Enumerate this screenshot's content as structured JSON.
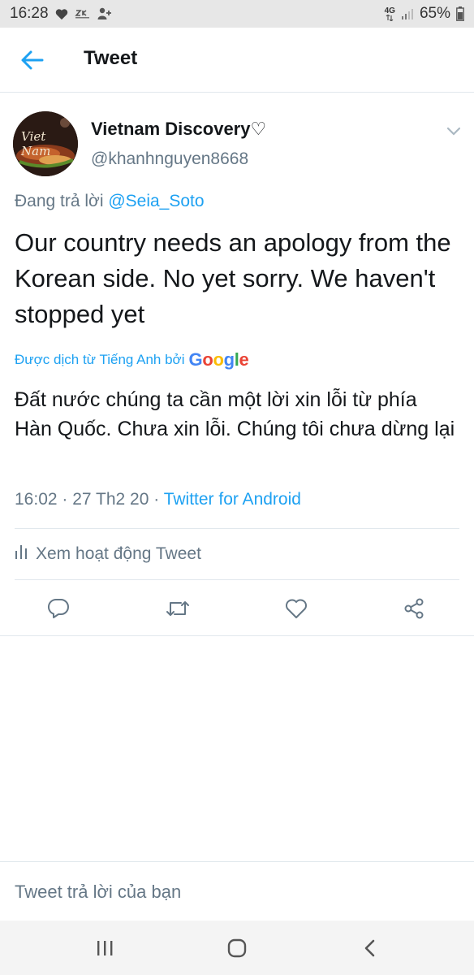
{
  "status_bar": {
    "time": "16:28",
    "network": "4G",
    "battery": "65%",
    "icons": [
      "heart-icon",
      "app-notification-icon",
      "add-user-icon",
      "signal-icon",
      "battery-icon"
    ]
  },
  "header": {
    "title": "Tweet",
    "back_icon": "arrow-left-icon"
  },
  "tweet": {
    "avatar_text": "Viet Nam",
    "display_name": "Vietnam Discovery♡",
    "handle": "@khanhnguyen8668",
    "replying_prefix": "Đang trả lời ",
    "replying_to": "@Seia_Soto",
    "text": "Our country needs an apology from the Korean side.  No yet sorry. We haven't stopped yet",
    "translated_by": "Được dịch từ Tiếng Anh bởi",
    "translation": "Đất nước chúng ta cần một lời xin lỗi từ phía Hàn Quốc. Chưa xin lỗi. Chúng tôi chưa dừng lại",
    "timestamp": "16:02 · 27 Th2 20 · ",
    "source": "Twitter for Android",
    "activity_label": "Xem hoạt động Tweet",
    "action_icons": [
      "reply-icon",
      "retweet-icon",
      "like-icon",
      "share-icon"
    ]
  },
  "reply_box": {
    "placeholder": "Tweet trả lời của bạn"
  },
  "nav_bar": {
    "icons": [
      "recent-apps-icon",
      "home-icon",
      "back-icon"
    ]
  },
  "colors": {
    "accent": "#1da1f2",
    "text": "#14171a",
    "secondary": "#657786",
    "divider": "#e1e8ed",
    "google_blue": "#4285f4",
    "google_red": "#ea4335",
    "google_yellow": "#fbbc05",
    "google_green": "#34a853"
  }
}
